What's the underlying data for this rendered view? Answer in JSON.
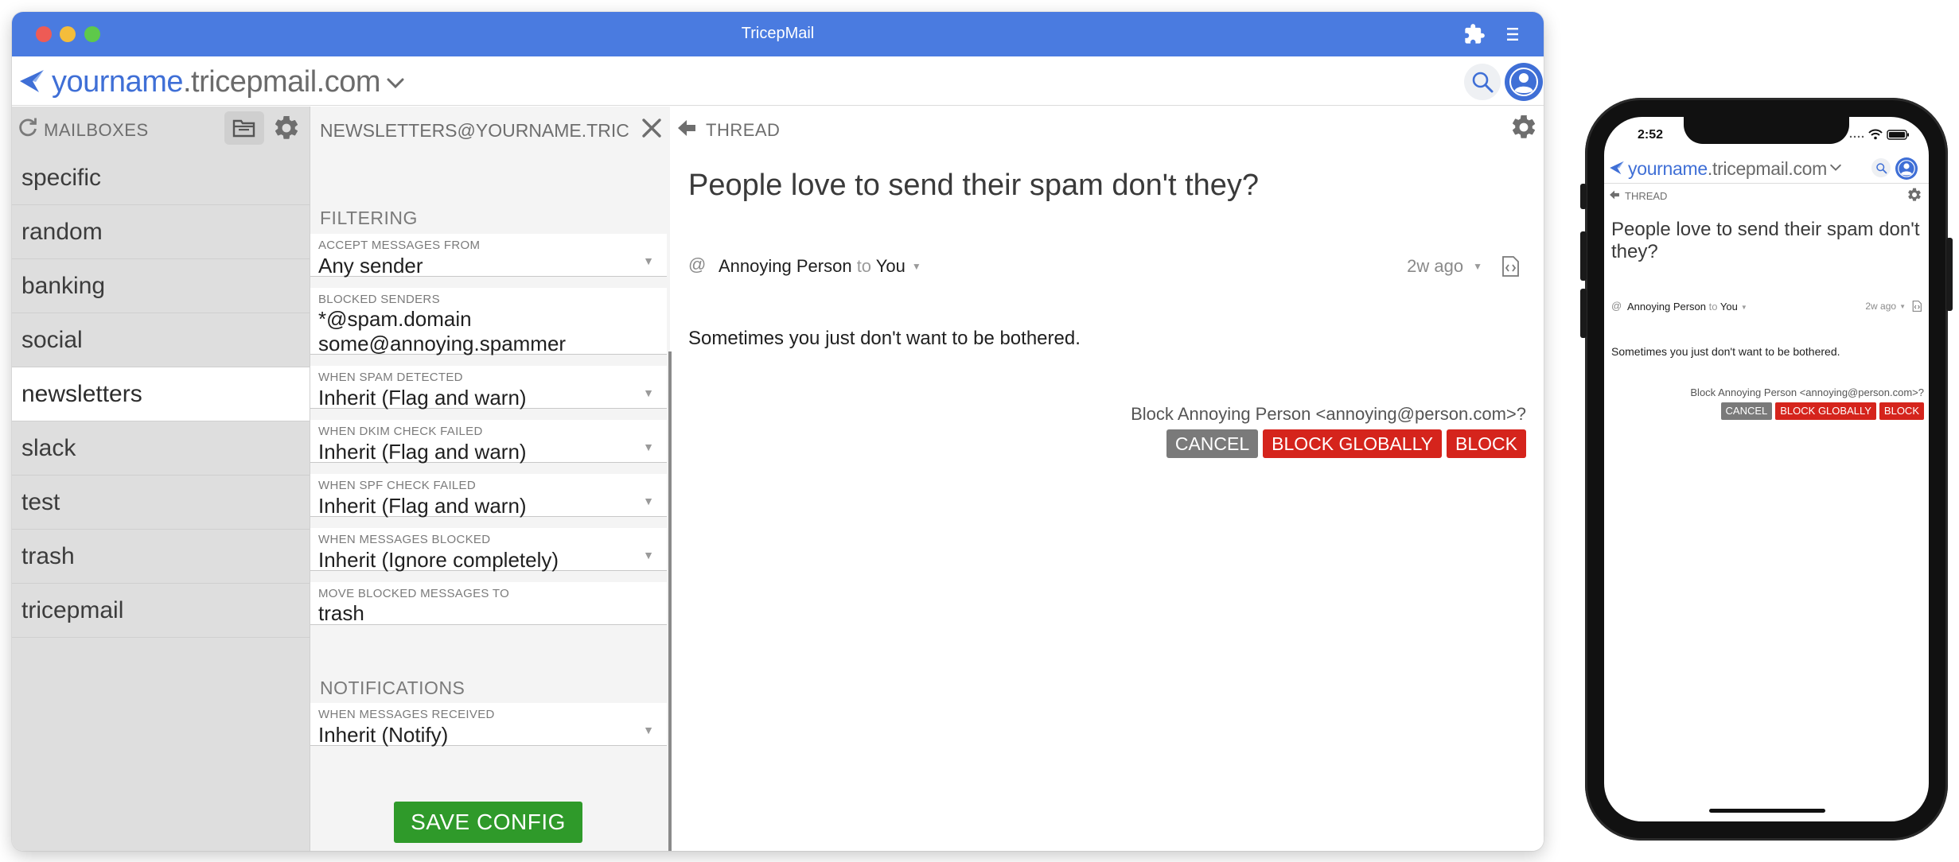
{
  "window": {
    "title": "TricepMail"
  },
  "topbar": {
    "domain_user": "yourname",
    "domain_host": ".tricepmail.com"
  },
  "mailboxes": {
    "header_label": "MAILBOXES",
    "items": [
      {
        "label": "specific"
      },
      {
        "label": "random"
      },
      {
        "label": "banking"
      },
      {
        "label": "social"
      },
      {
        "label": "newsletters"
      },
      {
        "label": "slack"
      },
      {
        "label": "test"
      },
      {
        "label": "trash"
      },
      {
        "label": "tricepmail"
      }
    ],
    "active": "newsletters"
  },
  "config": {
    "title": "NEWSLETTERS@YOURNAME.TRIC",
    "filtering_title": "FILTERING",
    "notifications_title": "NOTIFICATIONS",
    "accept_from": {
      "label": "ACCEPT MESSAGES FROM",
      "value": "Any sender"
    },
    "blocked_senders": {
      "label": "BLOCKED SENDERS",
      "line1": "*@spam.domain",
      "line2": "some@annoying.spammer"
    },
    "spam_detected": {
      "label": "WHEN SPAM DETECTED",
      "value": "Inherit (Flag and warn)"
    },
    "dkim_failed": {
      "label": "WHEN DKIM CHECK FAILED",
      "value": "Inherit (Flag and warn)"
    },
    "spf_failed": {
      "label": "WHEN SPF CHECK FAILED",
      "value": "Inherit (Flag and warn)"
    },
    "messages_blocked": {
      "label": "WHEN MESSAGES BLOCKED",
      "value": "Inherit (Ignore completely)"
    },
    "move_blocked": {
      "label": "MOVE BLOCKED MESSAGES TO",
      "value": "trash"
    },
    "messages_received": {
      "label": "WHEN MESSAGES RECEIVED",
      "value": "Inherit (Notify)"
    },
    "save_label": "SAVE CONFIG"
  },
  "thread": {
    "header_label": "THREAD",
    "subject": "People love to send their spam don't they?",
    "from": "Annoying Person",
    "to_word": "to",
    "to": "You",
    "time_ago": "2w ago",
    "body": "Sometimes you just don't want to be bothered.",
    "block_prompt": "Block Annoying Person <annoying@person.com>?",
    "cancel_label": "CANCEL",
    "block_globally_label": "BLOCK GLOBALLY",
    "block_label": "BLOCK"
  },
  "phone": {
    "time": "2:52",
    "subject": "People love to send their spam don't they?"
  },
  "colors": {
    "titlebar": "#4a7be0",
    "brand_blue": "#3f6fd6",
    "danger": "#d5241c",
    "save_green": "#2f9a2a",
    "cancel_gray": "#7a7a7a"
  }
}
